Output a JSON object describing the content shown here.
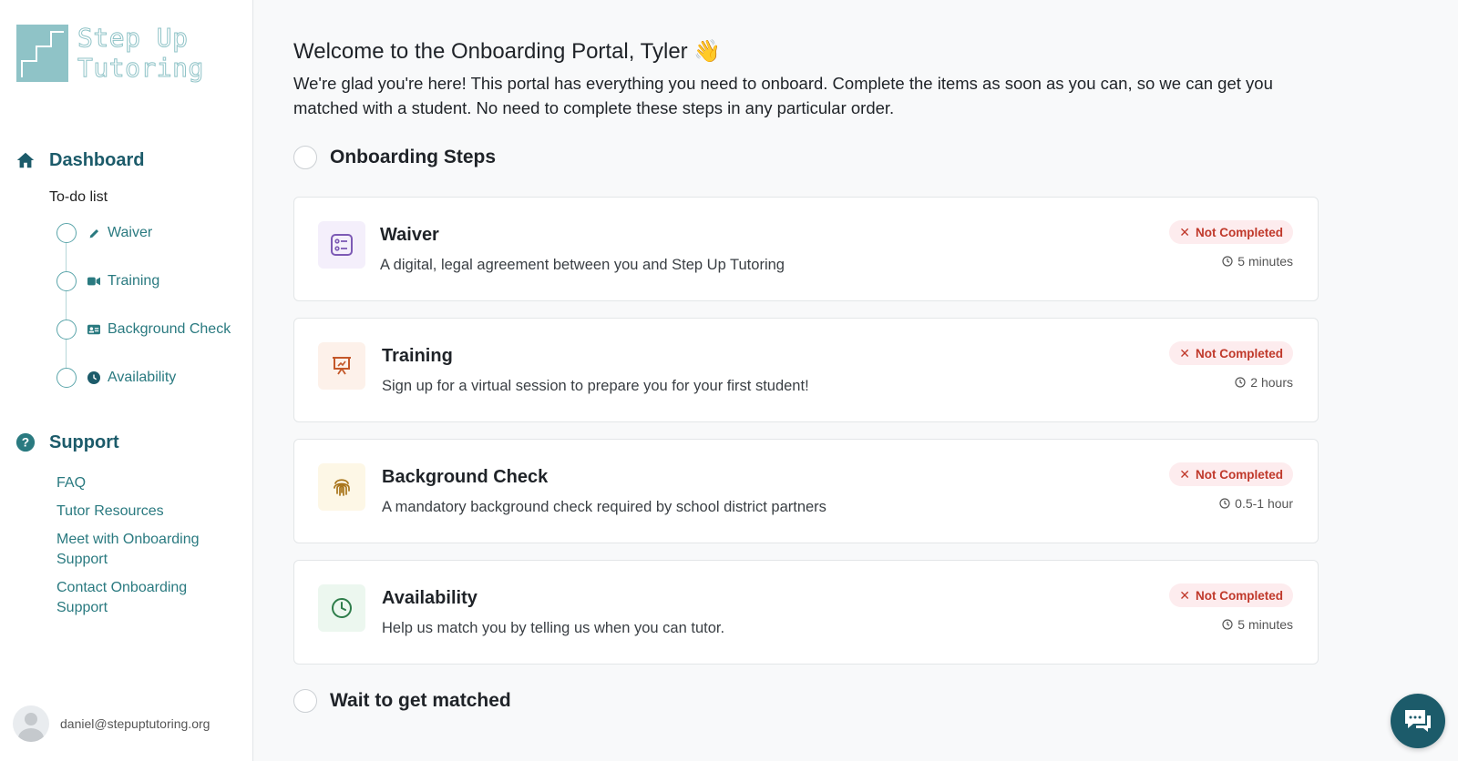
{
  "brand": {
    "line1": "Step Up",
    "line2": "Tutoring"
  },
  "sidebar": {
    "dashboard_label": "Dashboard",
    "todo_label": "To-do list",
    "steps": [
      {
        "label": "Waiver",
        "icon": "pencil-icon"
      },
      {
        "label": "Training",
        "icon": "video-icon"
      },
      {
        "label": "Background Check",
        "icon": "id-card-icon"
      },
      {
        "label": "Availability",
        "icon": "clock-icon"
      }
    ],
    "support_label": "Support",
    "support_links": [
      "FAQ",
      "Tutor Resources",
      "Meet with Onboarding Support",
      "Contact Onboarding Support"
    ],
    "user_email": "daniel@stepuptutoring.org"
  },
  "main": {
    "welcome": "Welcome to the Onboarding Portal, Tyler 👋",
    "intro": "We're glad you're here! This portal has everything you need to onboard. Complete the items as soon as you can, so we can get you matched with a student. No need to complete these steps in any particular order.",
    "section1_title": "Onboarding Steps",
    "cards": [
      {
        "title": "Waiver",
        "desc": "A digital, legal agreement between you and Step Up Tutoring",
        "status": "Not Completed",
        "duration": "5 minutes",
        "icon": "checklist-icon"
      },
      {
        "title": "Training",
        "desc": "Sign up for a virtual session to prepare you for your first student!",
        "status": "Not Completed",
        "duration": "2 hours",
        "icon": "presentation-icon"
      },
      {
        "title": "Background Check",
        "desc": "A mandatory background check required by school district partners",
        "status": "Not Completed",
        "duration": "0.5-1 hour",
        "icon": "fingerprint-icon"
      },
      {
        "title": "Availability",
        "desc": "Help us match you by telling us when you can tutor.",
        "status": "Not Completed",
        "duration": "5 minutes",
        "icon": "clock-icon"
      }
    ],
    "section2_title": "Wait to get matched"
  },
  "colors": {
    "brand": "#1c5b6a",
    "accent": "#2a7a80",
    "status_bg": "#fdecee",
    "status_text": "#c0392b"
  }
}
